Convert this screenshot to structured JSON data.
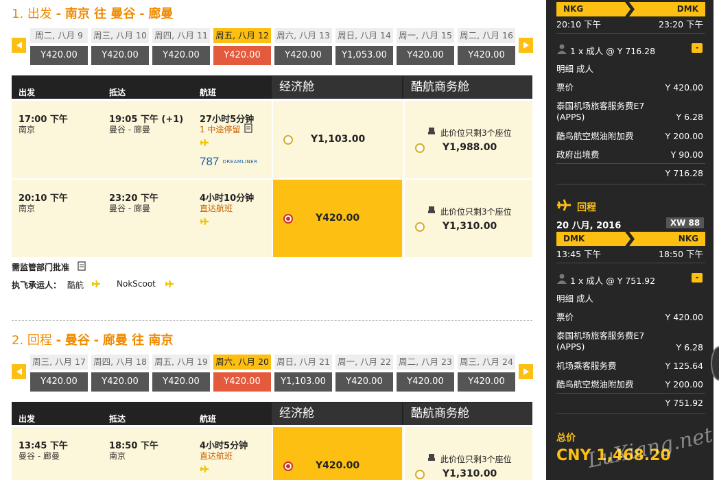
{
  "outbound": {
    "step": "1.",
    "label": "出发",
    "sep1": "-",
    "route": "南京 往 曼谷",
    "sep2": "-",
    "airport": "廊曼",
    "dates": [
      {
        "day": "周二, 八月 9",
        "price": "Y420.00"
      },
      {
        "day": "周三, 八月 10",
        "price": "Y420.00"
      },
      {
        "day": "周四, 八月 11",
        "price": "Y420.00"
      },
      {
        "day": "周五, 八月 12",
        "price": "Y420.00"
      },
      {
        "day": "周六, 八月 13",
        "price": "Y420.00"
      },
      {
        "day": "周日, 八月 14",
        "price": "Y1,053.00"
      },
      {
        "day": "周一, 八月 15",
        "price": "Y420.00"
      },
      {
        "day": "周二, 八月 16",
        "price": "Y420.00"
      }
    ],
    "flights": [
      {
        "dep_time": "17:00 下午",
        "dep_city": "南京",
        "arr_time": "19:05 下午 (+1)",
        "arr_city": "曼谷 - 廊曼",
        "duration": "27小时5分钟",
        "stops": "1 中途停留",
        "aircraft_num": "787",
        "aircraft_name": "DREAMLINER",
        "eco": "Y1,103.00",
        "biz_note": "此价位只剩3个座位",
        "biz": "Y1,988.00"
      },
      {
        "dep_time": "20:10 下午",
        "dep_city": "南京",
        "arr_time": "23:20 下午",
        "arr_city": "曼谷 - 廊曼",
        "duration": "4小时10分钟",
        "stops": "直达航班",
        "eco": "Y420.00",
        "biz_note": "此价位只剩3个座位",
        "biz": "Y1,310.00"
      }
    ]
  },
  "return": {
    "step": "2.",
    "label": "回程",
    "sep1": "-",
    "route": "曼谷",
    "sep2": "-",
    "airport": "廊曼 往 南京",
    "dates": [
      {
        "day": "周三, 八月 17",
        "price": "Y420.00"
      },
      {
        "day": "周四, 八月 18",
        "price": "Y420.00"
      },
      {
        "day": "周五, 八月 19",
        "price": "Y420.00"
      },
      {
        "day": "周六, 八月 20",
        "price": "Y420.00"
      },
      {
        "day": "周日, 八月 21",
        "price": "Y1,103.00"
      },
      {
        "day": "周一, 八月 22",
        "price": "Y420.00"
      },
      {
        "day": "周二, 八月 23",
        "price": "Y420.00"
      },
      {
        "day": "周三, 八月 24",
        "price": "Y420.00"
      }
    ],
    "flights": [
      {
        "dep_time": "13:45 下午",
        "dep_city": "曼谷 - 廊曼",
        "arr_time": "18:50 下午",
        "arr_city": "南京",
        "duration": "4小时5分钟",
        "stops": "直达航班",
        "eco": "Y420.00",
        "biz_note": "此价位只剩3个座位",
        "biz": "Y1,310.00"
      }
    ]
  },
  "table": {
    "col_depart": "出发",
    "col_arrive": "抵达",
    "col_flight": "航班",
    "col_eco": "经济舱",
    "col_biz": "酷航商务舱"
  },
  "notes": {
    "approval": "需监管部门批准",
    "carrier_label": "执飞承运人：",
    "carrier1": "酷航",
    "carrier2": "NokScoot"
  },
  "sidebar": {
    "out": {
      "from": "NKG",
      "to": "DMK",
      "dep": "20:10 下午",
      "arr": "23:20 下午",
      "pax": "1 x 成人 @ Y 716.28",
      "toggle": "-",
      "detail": "明细 成人",
      "items": [
        {
          "label": "票价",
          "value": "Y 420.00"
        },
        {
          "label": "泰国机场旅客服务费E7 (APPS)",
          "value": "Y 6.28"
        },
        {
          "label": "酷鸟航空燃油附加费",
          "value": "Y 200.00"
        },
        {
          "label": "政府出境费",
          "value": "Y 90.00"
        }
      ],
      "subtotal": "Y 716.28"
    },
    "ret": {
      "title": "回程",
      "date": "20 八月, 2016",
      "flight": "XW 88",
      "from": "DMK",
      "to": "NKG",
      "dep": "13:45 下午",
      "arr": "18:50 下午",
      "pax": "1 x 成人 @ Y 751.92",
      "toggle": "-",
      "detail": "明细 成人",
      "items": [
        {
          "label": "票价",
          "value": "Y 420.00"
        },
        {
          "label": "泰国机场旅客服务费E7 (APPS)",
          "value": "Y 6.28"
        },
        {
          "label": "机场乘客服务费",
          "value": "Y 125.64"
        },
        {
          "label": "酷鸟航空燃油附加费",
          "value": "Y 200.00"
        }
      ],
      "subtotal": "Y 751.92"
    },
    "total_label": "总价",
    "total": "CNY 1,468.20"
  },
  "watermark": "LuXiang.net",
  "colors": {
    "accent": "#fcbf12",
    "selected_date_price": "#e45a3c",
    "title_orange": "#f08a00",
    "row_bg": "#fcf6da",
    "header_bg": "#222222",
    "sidebar_bg": "#262626"
  }
}
